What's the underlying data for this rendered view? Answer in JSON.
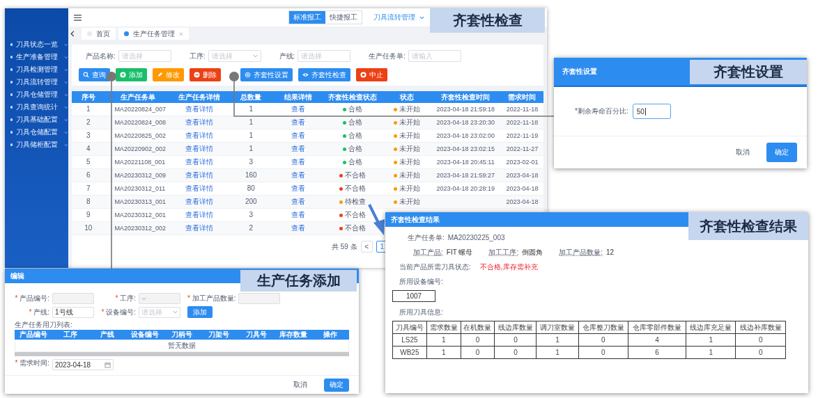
{
  "main": {
    "callout": "齐套性检查",
    "sidebar": {
      "items": [
        "刀具状态一览",
        "生产准备管理",
        "刀具检测管理",
        "刀具流转管理",
        "刀具仓储管理",
        "刀具查询统计",
        "刀具基础配置",
        "刀具仓储配置",
        "刀具储柜配置"
      ]
    },
    "header": {
      "report_modes": [
        {
          "label": "标准报工",
          "selected": true
        },
        {
          "label": "快捷报工",
          "selected": false
        }
      ],
      "menu": "刀具流转管理"
    },
    "tabs": [
      {
        "label": "首页",
        "selected": false,
        "closable": false
      },
      {
        "label": "生产任务管理",
        "selected": true,
        "closable": true
      }
    ],
    "filters": [
      {
        "label": "产品名称:",
        "placeholder": "请选择",
        "kind": "input"
      },
      {
        "label": "工序:",
        "placeholder": "请选择",
        "kind": "select"
      },
      {
        "label": "产线:",
        "placeholder": "请选择",
        "kind": "input"
      },
      {
        "label": "生产任务单:",
        "placeholder": "请输入",
        "kind": "input"
      }
    ],
    "button_groups": [
      [
        {
          "label": "查询",
          "color": "#2d8cf0"
        },
        {
          "label": "添加",
          "color": "#19be6b"
        },
        {
          "label": "修改",
          "color": "#ff9900"
        },
        {
          "label": "删除",
          "color": "#ed4014"
        }
      ],
      [
        {
          "label": "齐套性设置",
          "color": "#2d8cf0"
        },
        {
          "label": "齐套性检查",
          "color": "#2d8cf0"
        },
        {
          "label": "中止",
          "color": "#ed4014"
        }
      ]
    ],
    "table": {
      "columns": [
        "序号",
        "生产任务单",
        "生产任务详情",
        "总数量",
        "结果详情",
        "齐套性检查状态",
        "状态",
        "齐套性检查时间",
        "需求时间"
      ],
      "rows": [
        {
          "no": "1",
          "order": "MA20220824_007",
          "detail": "查看详情",
          "total": "1",
          "result": "查看",
          "check_status": {
            "text": "合格",
            "color": "#19be6b"
          },
          "state": {
            "text": "未开始",
            "color": "#ff9900"
          },
          "check_time": "2023-04-18 21:59:18",
          "demand_time": "2022-11-18"
        },
        {
          "no": "2",
          "order": "MA20220824_008",
          "detail": "查看详情",
          "total": "1",
          "result": "查看",
          "check_status": {
            "text": "合格",
            "color": "#19be6b"
          },
          "state": {
            "text": "未开始",
            "color": "#ff9900"
          },
          "check_time": "2023-04-18 23:20:30",
          "demand_time": "2022-11-18"
        },
        {
          "no": "3",
          "order": "MA20220825_002",
          "detail": "查看详情",
          "total": "1",
          "result": "查看",
          "check_status": {
            "text": "合格",
            "color": "#19be6b"
          },
          "state": {
            "text": "未开始",
            "color": "#ff9900"
          },
          "check_time": "2023-04-18 23:02:00",
          "demand_time": "2022-11-19"
        },
        {
          "no": "4",
          "order": "MA20220902_002",
          "detail": "查看详情",
          "total": "1",
          "result": "查看",
          "check_status": {
            "text": "合格",
            "color": "#19be6b"
          },
          "state": {
            "text": "未开始",
            "color": "#ff9900"
          },
          "check_time": "2023-04-18 23:02:15",
          "demand_time": "2022-11-27"
        },
        {
          "no": "5",
          "order": "MA20221108_001",
          "detail": "查看详情",
          "total": "3",
          "result": "查看",
          "check_status": {
            "text": "合格",
            "color": "#19be6b"
          },
          "state": {
            "text": "未开始",
            "color": "#ff9900"
          },
          "check_time": "2023-04-18 20:45:11",
          "demand_time": "2023-02-01"
        },
        {
          "no": "6",
          "order": "MA20230312_009",
          "detail": "查看详情",
          "total": "160",
          "result": "查看",
          "check_status": {
            "text": "不合格",
            "color": "#ed4014"
          },
          "state": {
            "text": "未开始",
            "color": "#ff9900"
          },
          "check_time": "2023-04-18 21:59:27",
          "demand_time": "2023-04-18"
        },
        {
          "no": "7",
          "order": "MA20230312_011",
          "detail": "查看详情",
          "total": "80",
          "result": "查看",
          "check_status": {
            "text": "不合格",
            "color": "#ed4014"
          },
          "state": {
            "text": "未开始",
            "color": "#ff9900"
          },
          "check_time": "2023-04-18 20:28:19",
          "demand_time": "2023-04-18"
        },
        {
          "no": "8",
          "order": "MA20230313_001",
          "detail": "查看详情",
          "total": "200",
          "result": "查看",
          "check_status": {
            "text": "待检查",
            "color": "#ff9900"
          },
          "state": {
            "text": "未开始",
            "color": "#ff9900"
          },
          "demand_time": "2023-04-18"
        },
        {
          "no": "9",
          "order": "MA20230312_001",
          "detail": "查看详情",
          "total": "3",
          "result": "查看",
          "check_status": {
            "text": "不合格",
            "color": "#ed4014"
          }
        },
        {
          "no": "10",
          "order": "MA20230312_002",
          "detail": "查看详情",
          "total": "2",
          "result": "查看",
          "check_status": {
            "text": "不合格",
            "color": "#ed4014"
          }
        }
      ]
    },
    "pagination": {
      "total": "共 59 条",
      "prev": "<",
      "pages": [
        {
          "label": "1",
          "selected": true
        }
      ]
    }
  },
  "settings_dialog": {
    "title": "齐套性设置",
    "callout": "齐套性设置",
    "field": {
      "label": "*剩余寿命百分比:",
      "value": "50"
    },
    "buttons": [
      {
        "label": "取消",
        "kind": "text"
      },
      {
        "label": "确定",
        "kind": "primary"
      }
    ]
  },
  "add_dialog": {
    "title": "编辑",
    "callout": "生产任务添加",
    "form_rows": [
      [
        {
          "mark": "*",
          "label": "产品编号:",
          "kind": "input",
          "disabled": true
        },
        {
          "mark": "*",
          "label": "工序:",
          "kind": "select",
          "disabled": true
        },
        {
          "mark": "*",
          "label": "加工产品数量:",
          "kind": "input",
          "disabled": true
        }
      ],
      [
        {
          "mark": "*",
          "label": "产线:",
          "kind": "input",
          "value": "1号线",
          "disabled": false
        },
        {
          "mark": "*",
          "label": "设备编号:",
          "kind": "select",
          "placeholder": "请选择",
          "disabled": false
        },
        {
          "kind": "button",
          "label": "添加"
        }
      ]
    ],
    "list_label": "生产任务用刀列表:",
    "columns": [
      "产品编号",
      "工序",
      "产线",
      "设备编号",
      "刀柄号",
      "刀架号",
      "刀具号",
      "库存数量",
      "操作"
    ],
    "empty_text": "暂无数据",
    "date_field": {
      "mark": "*",
      "label": "需求时间:",
      "value": "2023-04-18"
    },
    "buttons": [
      {
        "label": "取消",
        "kind": "text"
      },
      {
        "label": "确定",
        "kind": "primary"
      }
    ]
  },
  "result_dialog": {
    "title": "齐套性检查结果",
    "callout": "齐套性检查结果",
    "order": {
      "label": "生产任务单:",
      "value": "MA20230225_003"
    },
    "product_info": [
      {
        "label": "加工产品:",
        "value": "FIT 螺母"
      },
      {
        "label": "加工工序:",
        "value": "倒圆角"
      },
      {
        "label": "加工产品数量:",
        "value": "12"
      }
    ],
    "status": {
      "label": "当前产品所需刀具状态:",
      "value": "不合格,库存需补充",
      "passed": false
    },
    "device_label": "所用设备编号:",
    "devices": [
      "1007"
    ],
    "tools_label": "所用刀具信息:",
    "tools_table": {
      "columns": [
        "刀具编号",
        "需求数量",
        "在机数量",
        "线边库数量",
        "调刀室数量",
        "仓库整刀数量",
        "仓库零部件数量",
        "线边库充足量",
        "线边补库数量"
      ],
      "rows": [
        [
          "LS25",
          "1",
          "0",
          "0",
          "1",
          "0",
          "4",
          "1",
          "0"
        ],
        [
          "WB25",
          "1",
          "0",
          "0",
          "1",
          "0",
          "6",
          "1",
          "0"
        ]
      ]
    }
  }
}
